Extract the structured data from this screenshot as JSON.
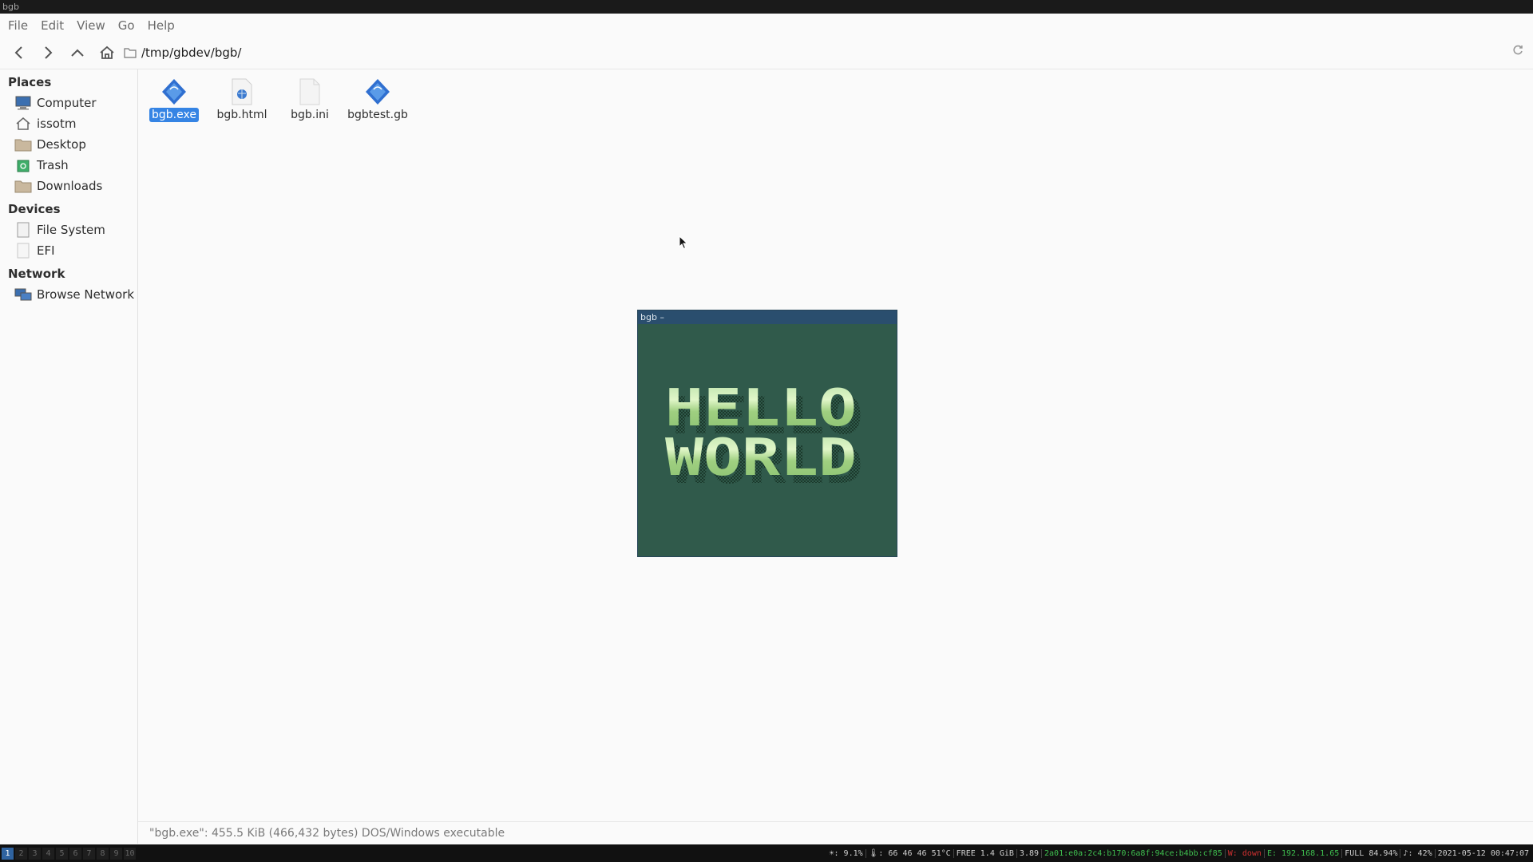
{
  "window": {
    "title": "bgb"
  },
  "menu": [
    "File",
    "Edit",
    "View",
    "Go",
    "Help"
  ],
  "location": {
    "path": "/tmp/gbdev/bgb/"
  },
  "sidebar": {
    "places_title": "Places",
    "places": [
      {
        "label": "Computer",
        "icon": "computer-icon"
      },
      {
        "label": "issotm",
        "icon": "home-icon"
      },
      {
        "label": "Desktop",
        "icon": "desktop-folder-icon"
      },
      {
        "label": "Trash",
        "icon": "trash-icon"
      },
      {
        "label": "Downloads",
        "icon": "downloads-folder-icon"
      }
    ],
    "devices_title": "Devices",
    "devices": [
      {
        "label": "File System",
        "icon": "drive-icon"
      },
      {
        "label": "EFI",
        "icon": "drive-icon"
      }
    ],
    "network_title": "Network",
    "network": [
      {
        "label": "Browse Network",
        "icon": "network-icon"
      }
    ]
  },
  "files": [
    {
      "name": "bgb.exe",
      "icon": "executable-icon",
      "selected": true
    },
    {
      "name": "bgb.html",
      "icon": "html-document-icon",
      "selected": false
    },
    {
      "name": "bgb.ini",
      "icon": "text-file-icon",
      "selected": false
    },
    {
      "name": "bgbtest.gb",
      "icon": "gameboy-rom-icon",
      "selected": false
    }
  ],
  "status": "\"bgb.exe\": 455.5 KiB (466,432 bytes) DOS/Windows executable",
  "emulator": {
    "title": "bgb  –",
    "screen_lines": [
      "HELLO",
      "WORLD"
    ]
  },
  "taskbar": {
    "workspaces": [
      "1",
      "2",
      "3",
      "4",
      "5",
      "6",
      "7",
      "8",
      "9",
      "10"
    ],
    "active_workspace": "1",
    "segments": [
      {
        "text": "☀: 9.1%",
        "color": "#cfcfcf"
      },
      {
        "text": "🌡: 66  46  46  51°C",
        "color": "#cfcfcf"
      },
      {
        "text": "FREE 1.4 GiB",
        "color": "#cfcfcf"
      },
      {
        "text": "3.89",
        "color": "#cfcfcf"
      },
      {
        "text": "2a01:e0a:2c4:b170:6a8f:94ce:b4bb:cf85",
        "color": "#3fbf4f"
      },
      {
        "text": "W: down",
        "color": "#d03030"
      },
      {
        "text": "E: 192.168.1.65",
        "color": "#3fbf4f"
      },
      {
        "text": "FULL 84.94%",
        "color": "#cfcfcf"
      },
      {
        "text": "♪: 42%",
        "color": "#cfcfcf"
      },
      {
        "text": "2021-05-12 00:47:07",
        "color": "#cfcfcf"
      }
    ]
  },
  "colors": {
    "selection": "#3584e4",
    "emulator_bg": "#305a4b",
    "emulator_titlebar": "#2a4e6e"
  }
}
